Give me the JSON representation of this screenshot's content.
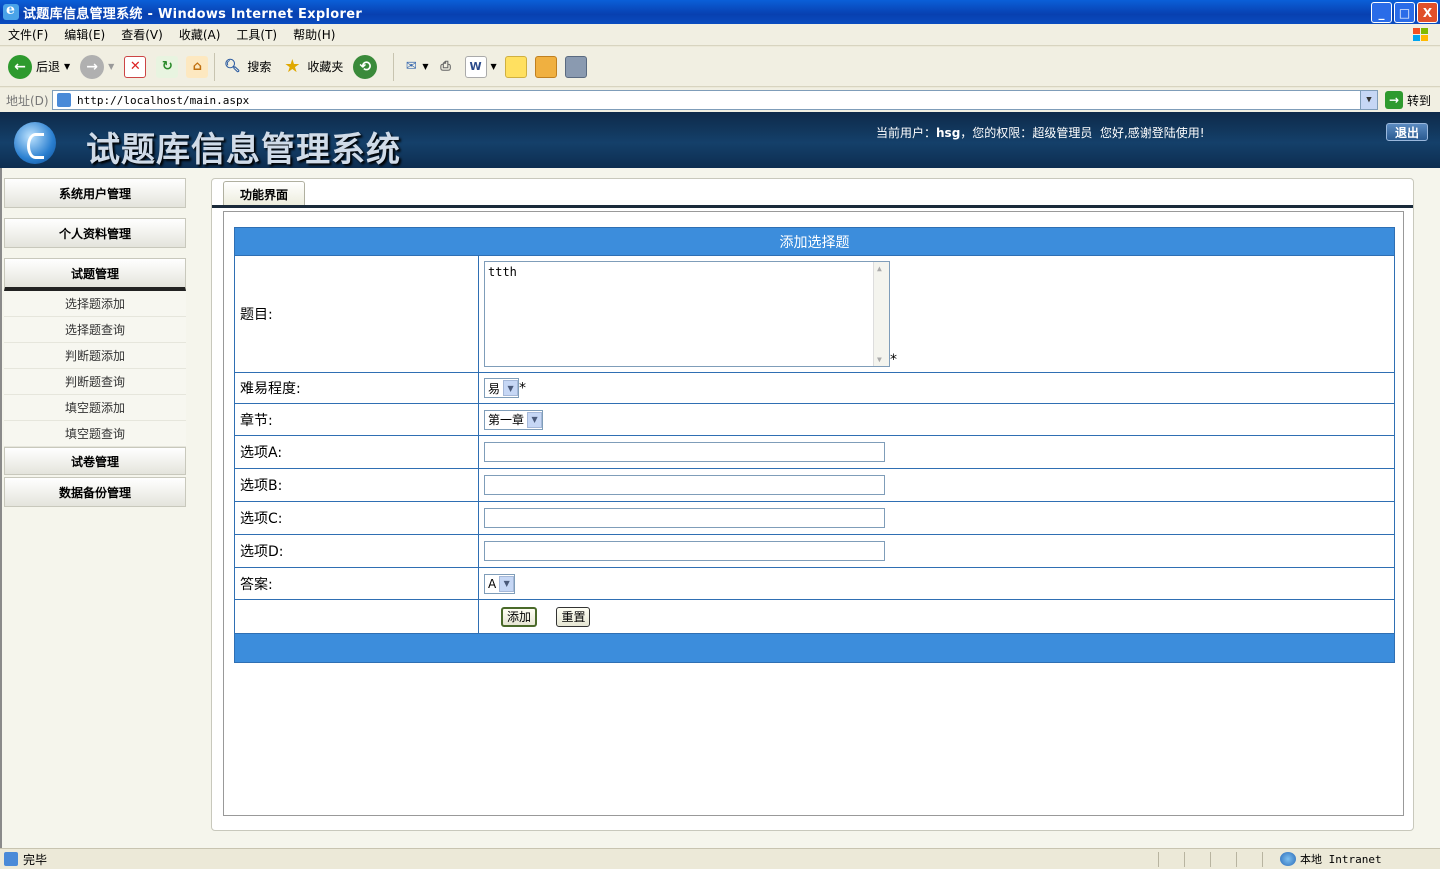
{
  "window": {
    "title": "试题库信息管理系统 - Windows Internet Explorer",
    "controls": [
      "_",
      "□",
      "X"
    ]
  },
  "menu": [
    "文件(F)",
    "编辑(E)",
    "查看(V)",
    "收藏(A)",
    "工具(T)",
    "帮助(H)"
  ],
  "toolbar": {
    "back": "后退",
    "search": "搜索",
    "favorites": "收藏夹"
  },
  "address": {
    "label": "地址(D)",
    "url": "http://localhost/main.aspx",
    "go": "转到"
  },
  "header": {
    "system_title": "试题库信息管理系统",
    "user_prefix": "当前用户：",
    "username": "hsg",
    "role_prefix": "，您的权限：",
    "role": "超级管理员",
    "welcome": "您好,感谢登陆使用!",
    "logout": "退出"
  },
  "sidebar": {
    "groups": [
      "系统用户管理",
      "个人资料管理",
      "试题管理",
      "试卷管理",
      "数据备份管理"
    ],
    "subitems": [
      "选择题添加",
      "选择题查询",
      "判断题添加",
      "判断题查询",
      "填空题添加",
      "填空题查询"
    ]
  },
  "tab": {
    "label": "功能界面"
  },
  "form": {
    "title": "添加选择题",
    "question_label": "题目:",
    "question_value": "ttth",
    "difficulty_label": "难易程度:",
    "difficulty_value": "易",
    "chapter_label": "章节:",
    "chapter_value": "第一章",
    "optionA_label": "选项A:",
    "optionB_label": "选项B:",
    "optionC_label": "选项C:",
    "optionD_label": "选项D:",
    "answer_label": "答案:",
    "answer_value": "A",
    "required_mark": "*",
    "add_button": "添加",
    "reset_button": "重置"
  },
  "status": {
    "text": "完毕",
    "zone": "本地 Intranet"
  },
  "colors": {
    "accent": "#3c8ddc",
    "header_bg": "#14406a",
    "title_bar": "#0a5fd8"
  }
}
